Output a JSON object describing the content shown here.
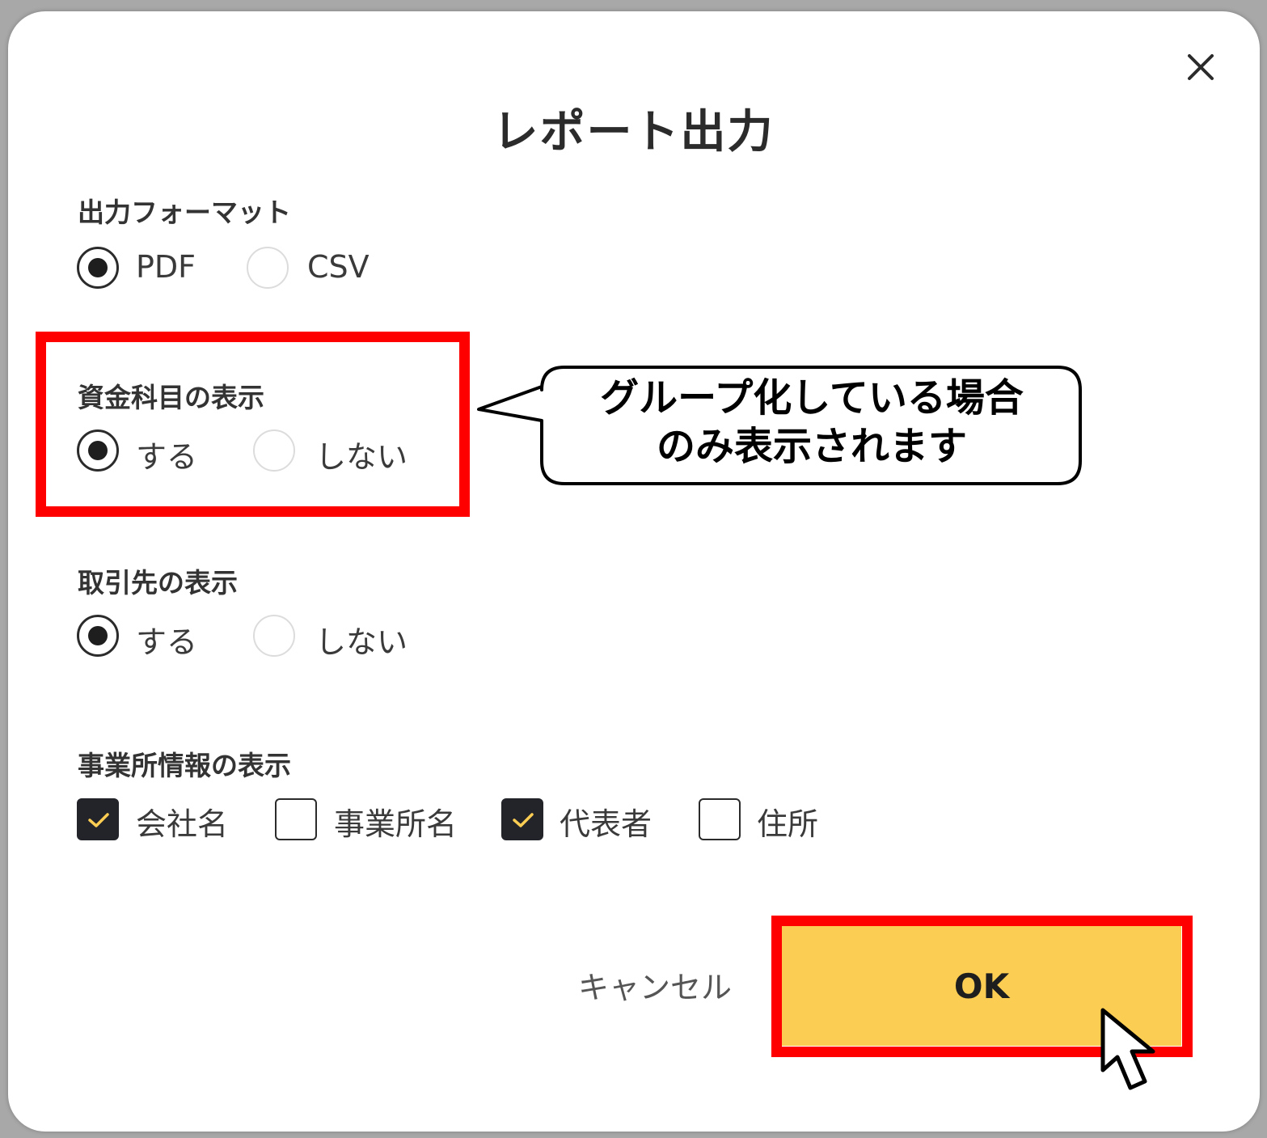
{
  "dialog": {
    "title": "レポート出力",
    "close_icon": "close-icon"
  },
  "output_format": {
    "label": "出力フォーマット",
    "options": [
      {
        "label": "PDF",
        "checked": true
      },
      {
        "label": "CSV",
        "checked": false
      }
    ]
  },
  "fund_account_display": {
    "label": "資金科目の表示",
    "options": [
      {
        "label": "する",
        "checked": true
      },
      {
        "label": "しない",
        "checked": false
      }
    ]
  },
  "partner_display": {
    "label": "取引先の表示",
    "options": [
      {
        "label": "する",
        "checked": true
      },
      {
        "label": "しない",
        "checked": false
      }
    ]
  },
  "office_info_display": {
    "label": "事業所情報の表示",
    "options": [
      {
        "label": "会社名",
        "checked": true
      },
      {
        "label": "事業所名",
        "checked": false
      },
      {
        "label": "代表者",
        "checked": true
      },
      {
        "label": "住所",
        "checked": false
      }
    ]
  },
  "callout": {
    "line1": "グループ化している場合",
    "line2": "のみ表示されます"
  },
  "actions": {
    "cancel_label": "キャンセル",
    "ok_label": "OK"
  },
  "colors": {
    "accent": "#fbcd52",
    "highlight": "#ff0000",
    "checkbox_tick": "#fbcd52"
  }
}
